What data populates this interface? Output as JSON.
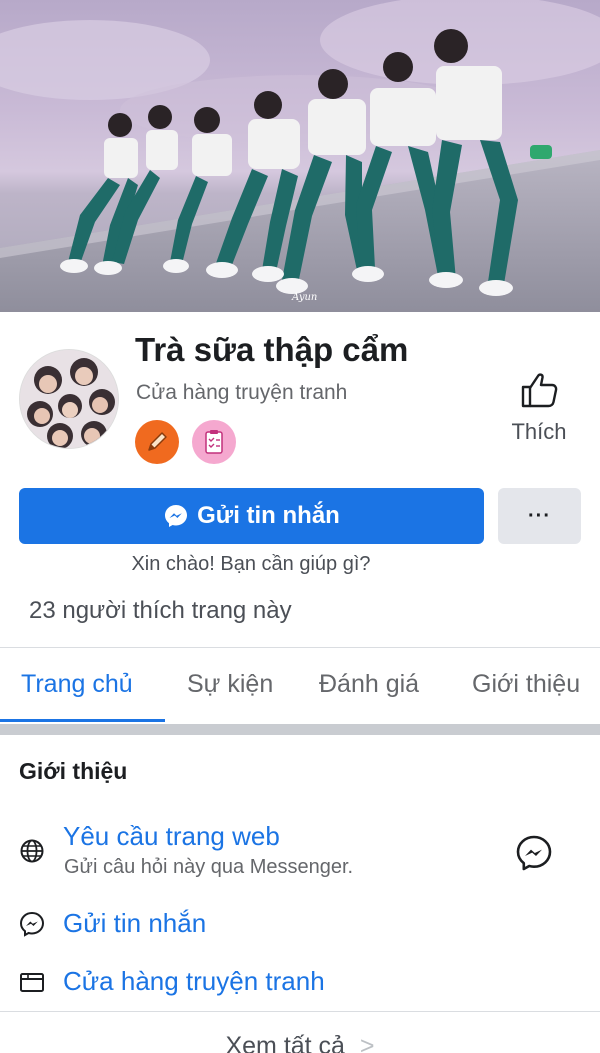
{
  "cover": {
    "watermark": "Ayun"
  },
  "page": {
    "name": "Trà sữa thập cẩm",
    "category": "Cửa hàng truyện tranh",
    "like_label": "Thích"
  },
  "actions": {
    "message_button": "Gửi tin nhắn",
    "more_button": "···",
    "greeting": "Xin chào! Bạn cần giúp gì?"
  },
  "likes_count": "23 người thích trang này",
  "tabs": [
    {
      "label": "Trang chủ",
      "active": true
    },
    {
      "label": "Sự kiện",
      "active": false
    },
    {
      "label": "Đánh giá",
      "active": false
    },
    {
      "label": "Giới thiệu",
      "active": false
    }
  ],
  "about": {
    "title": "Giới thiệu",
    "items": [
      {
        "icon": "globe-icon",
        "title": "Yêu cầu trang web",
        "subtitle": "Gửi câu hỏi này qua Messenger."
      },
      {
        "icon": "messenger-icon",
        "title": "Gửi tin nhắn"
      },
      {
        "icon": "storefront-icon",
        "title": "Cửa hàng truyện tranh"
      }
    ],
    "see_all": "Xem tất cả"
  },
  "colors": {
    "accent": "#1b74e4",
    "badge_orange": "#f06a1f",
    "badge_pink": "#f5a8cf"
  }
}
